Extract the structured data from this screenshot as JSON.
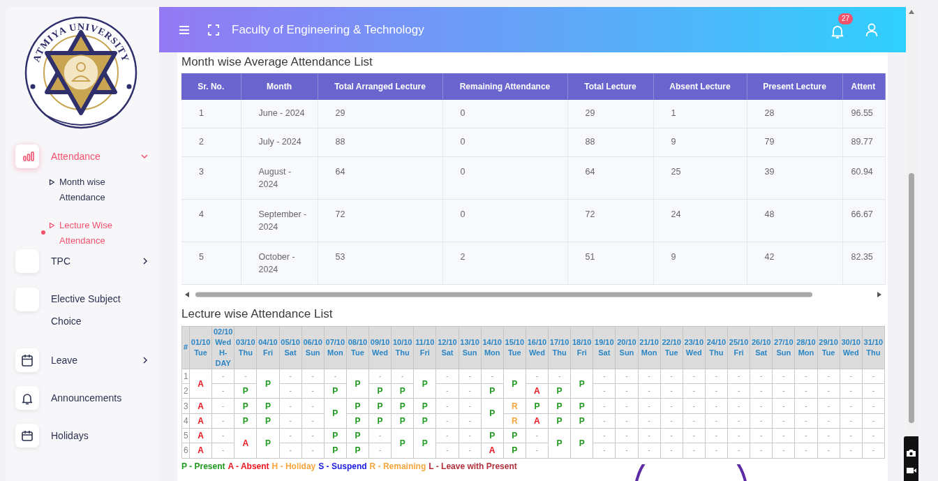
{
  "header": {
    "title": "Faculty of Engineering & Technology",
    "notification_count": "27"
  },
  "sidebar": {
    "logo": {
      "name": "ATMIYA UNIVERSITY"
    },
    "items": [
      {
        "label": "Attendance",
        "kind": "menu",
        "selected": true,
        "expanded": true,
        "children": [
          {
            "label": "Month wise Attendance",
            "selected": false
          },
          {
            "label": "Lecture Wise Attendance",
            "selected": true
          }
        ]
      },
      {
        "label": "TPC",
        "kind": "menu",
        "selected": false,
        "expanded": false
      },
      {
        "label": "Elective Subject Choice",
        "kind": "link",
        "selected": false
      },
      {
        "label": "Leave",
        "kind": "menu",
        "selected": false,
        "expanded": false
      },
      {
        "label": "Announcements",
        "kind": "link",
        "selected": false
      },
      {
        "label": "Holidays",
        "kind": "link",
        "selected": false
      }
    ]
  },
  "month_table": {
    "title": "Month wise Average Attendance List",
    "columns": [
      "Sr. No.",
      "Month",
      "Total Arranged Lecture",
      "Remaining Attendance",
      "Total Lecture",
      "Absent Lecture",
      "Present Lecture",
      "Attent"
    ],
    "rows": [
      [
        "1",
        "June - 2024",
        "29",
        "0",
        "29",
        "1",
        "28",
        "96.55"
      ],
      [
        "2",
        "July - 2024",
        "88",
        "0",
        "88",
        "9",
        "79",
        "89.77"
      ],
      [
        "3",
        "August - 2024",
        "64",
        "0",
        "64",
        "25",
        "39",
        "60.94"
      ],
      [
        "4",
        "September - 2024",
        "72",
        "0",
        "72",
        "24",
        "48",
        "66.67"
      ],
      [
        "5",
        "October - 2024",
        "53",
        "2",
        "51",
        "9",
        "42",
        "82.35"
      ]
    ]
  },
  "lecture_table": {
    "title": "Lecture wise Attendance List",
    "number_header": "#",
    "lecture_numbers": [
      "1",
      "2",
      "3",
      "4",
      "5",
      "6"
    ],
    "days": [
      {
        "date": "01/10",
        "weekday": "Tue",
        "slots": [
          {
            "mark": "A",
            "kind": "absent",
            "merged": false
          },
          {
            "merged": true
          },
          {
            "mark": "A",
            "kind": "absent",
            "merged": false
          },
          {
            "mark": "A",
            "kind": "absent",
            "merged": false
          },
          {
            "mark": "A",
            "kind": "absent",
            "merged": false
          },
          {
            "mark": "A",
            "kind": "absent",
            "merged": false
          }
        ]
      },
      {
        "date": "02/10",
        "weekday": "Wed",
        "note": "H-DAY",
        "slots": [
          {
            "mark": "-",
            "kind": "none",
            "merged": false
          },
          {
            "mark": "-",
            "kind": "none",
            "merged": false
          },
          {
            "mark": "-",
            "kind": "none",
            "merged": false
          },
          {
            "mark": "-",
            "kind": "none",
            "merged": false
          },
          {
            "mark": "-",
            "kind": "none",
            "merged": false
          },
          {
            "mark": "-",
            "kind": "none",
            "merged": false
          }
        ]
      },
      {
        "date": "03/10",
        "weekday": "Thu",
        "slots": [
          {
            "mark": "-",
            "kind": "none",
            "merged": false
          },
          {
            "mark": "P",
            "kind": "present",
            "merged": false
          },
          {
            "mark": "P",
            "kind": "present",
            "merged": false
          },
          {
            "mark": "P",
            "kind": "present",
            "merged": false
          },
          {
            "mark": "A",
            "kind": "absent",
            "merged": false
          },
          {
            "merged": true
          }
        ]
      },
      {
        "date": "04/10",
        "weekday": "Fri",
        "slots": [
          {
            "mark": "P",
            "kind": "present",
            "merged": false
          },
          {
            "merged": true
          },
          {
            "mark": "P",
            "kind": "present",
            "merged": false
          },
          {
            "mark": "P",
            "kind": "present",
            "merged": false
          },
          {
            "mark": "P",
            "kind": "present",
            "merged": false
          },
          {
            "merged": true
          }
        ]
      },
      {
        "date": "05/10",
        "weekday": "Sat",
        "slots": [
          {
            "mark": "-",
            "kind": "none",
            "merged": false
          },
          {
            "mark": "-",
            "kind": "none",
            "merged": false
          },
          {
            "mark": "-",
            "kind": "none",
            "merged": false
          },
          {
            "mark": "-",
            "kind": "none",
            "merged": false
          },
          {
            "mark": "-",
            "kind": "none",
            "merged": false
          },
          {
            "mark": "-",
            "kind": "none",
            "merged": false
          }
        ]
      },
      {
        "date": "06/10",
        "weekday": "Sun",
        "slots": [
          {
            "mark": "-",
            "kind": "none",
            "merged": false
          },
          {
            "mark": "-",
            "kind": "none",
            "merged": false
          },
          {
            "mark": "-",
            "kind": "none",
            "merged": false
          },
          {
            "mark": "-",
            "kind": "none",
            "merged": false
          },
          {
            "mark": "-",
            "kind": "none",
            "merged": false
          },
          {
            "mark": "-",
            "kind": "none",
            "merged": false
          }
        ]
      },
      {
        "date": "07/10",
        "weekday": "Mon",
        "slots": [
          {
            "mark": "-",
            "kind": "none",
            "merged": false
          },
          {
            "mark": "P",
            "kind": "present",
            "merged": false
          },
          {
            "mark": "P",
            "kind": "present",
            "merged": false
          },
          {
            "merged": true
          },
          {
            "mark": "P",
            "kind": "present",
            "merged": false
          },
          {
            "mark": "P",
            "kind": "present",
            "merged": false
          }
        ]
      },
      {
        "date": "08/10",
        "weekday": "Tue",
        "slots": [
          {
            "mark": "P",
            "kind": "present",
            "merged": false
          },
          {
            "merged": true
          },
          {
            "mark": "P",
            "kind": "present",
            "merged": false
          },
          {
            "mark": "P",
            "kind": "present",
            "merged": false
          },
          {
            "mark": "P",
            "kind": "present",
            "merged": false
          },
          {
            "mark": "P",
            "kind": "present",
            "merged": false
          }
        ]
      },
      {
        "date": "09/10",
        "weekday": "Wed",
        "slots": [
          {
            "mark": "-",
            "kind": "none",
            "merged": false
          },
          {
            "mark": "P",
            "kind": "present",
            "merged": false
          },
          {
            "mark": "P",
            "kind": "present",
            "merged": false
          },
          {
            "mark": "P",
            "kind": "present",
            "merged": false
          },
          {
            "mark": "-",
            "kind": "none",
            "merged": false
          },
          {
            "mark": "-",
            "kind": "none",
            "merged": false
          }
        ]
      },
      {
        "date": "10/10",
        "weekday": "Thu",
        "slots": [
          {
            "mark": "-",
            "kind": "none",
            "merged": false
          },
          {
            "mark": "P",
            "kind": "present",
            "merged": false
          },
          {
            "mark": "P",
            "kind": "present",
            "merged": false
          },
          {
            "mark": "P",
            "kind": "present",
            "merged": false
          },
          {
            "mark": "P",
            "kind": "present",
            "merged": false
          },
          {
            "merged": true
          }
        ]
      },
      {
        "date": "11/10",
        "weekday": "Fri",
        "slots": [
          {
            "mark": "P",
            "kind": "present",
            "merged": false
          },
          {
            "merged": true
          },
          {
            "mark": "P",
            "kind": "present",
            "merged": false
          },
          {
            "mark": "P",
            "kind": "present",
            "merged": false
          },
          {
            "mark": "P",
            "kind": "present",
            "merged": false
          },
          {
            "merged": true
          }
        ]
      },
      {
        "date": "12/10",
        "weekday": "Sat",
        "slots": [
          {
            "mark": "-",
            "kind": "none",
            "merged": false
          },
          {
            "mark": "-",
            "kind": "none",
            "merged": false
          },
          {
            "mark": "-",
            "kind": "none",
            "merged": false
          },
          {
            "mark": "-",
            "kind": "none",
            "merged": false
          },
          {
            "mark": "-",
            "kind": "none",
            "merged": false
          },
          {
            "mark": "-",
            "kind": "none",
            "merged": false
          }
        ]
      },
      {
        "date": "13/10",
        "weekday": "Sun",
        "slots": [
          {
            "mark": "-",
            "kind": "none",
            "merged": false
          },
          {
            "mark": "-",
            "kind": "none",
            "merged": false
          },
          {
            "mark": "-",
            "kind": "none",
            "merged": false
          },
          {
            "mark": "-",
            "kind": "none",
            "merged": false
          },
          {
            "mark": "-",
            "kind": "none",
            "merged": false
          },
          {
            "mark": "-",
            "kind": "none",
            "merged": false
          }
        ]
      },
      {
        "date": "14/10",
        "weekday": "Mon",
        "slots": [
          {
            "mark": "-",
            "kind": "none",
            "merged": false
          },
          {
            "mark": "P",
            "kind": "present",
            "merged": false
          },
          {
            "mark": "P",
            "kind": "present",
            "merged": false
          },
          {
            "merged": true
          },
          {
            "mark": "P",
            "kind": "present",
            "merged": false
          },
          {
            "mark": "A",
            "kind": "absent",
            "merged": false
          }
        ]
      },
      {
        "date": "15/10",
        "weekday": "Tue",
        "slots": [
          {
            "mark": "P",
            "kind": "present",
            "merged": false
          },
          {
            "merged": true
          },
          {
            "mark": "R",
            "kind": "remaining",
            "merged": false
          },
          {
            "mark": "R",
            "kind": "remaining",
            "merged": false
          },
          {
            "mark": "P",
            "kind": "present",
            "merged": false
          },
          {
            "mark": "P",
            "kind": "present",
            "merged": false
          }
        ]
      },
      {
        "date": "16/10",
        "weekday": "Wed",
        "slots": [
          {
            "mark": "-",
            "kind": "none",
            "merged": false
          },
          {
            "mark": "A",
            "kind": "absent",
            "merged": false
          },
          {
            "mark": "P",
            "kind": "present",
            "merged": false
          },
          {
            "mark": "A",
            "kind": "absent",
            "merged": false
          },
          {
            "mark": "-",
            "kind": "none",
            "merged": false
          },
          {
            "mark": "-",
            "kind": "none",
            "merged": false
          }
        ]
      },
      {
        "date": "17/10",
        "weekday": "Thu",
        "slots": [
          {
            "mark": "-",
            "kind": "none",
            "merged": false
          },
          {
            "mark": "P",
            "kind": "present",
            "merged": false
          },
          {
            "mark": "P",
            "kind": "present",
            "merged": false
          },
          {
            "mark": "P",
            "kind": "present",
            "merged": false
          },
          {
            "mark": "P",
            "kind": "present",
            "merged": false
          },
          {
            "merged": true
          }
        ]
      },
      {
        "date": "18/10",
        "weekday": "Fri",
        "slots": [
          {
            "mark": "P",
            "kind": "present",
            "merged": false
          },
          {
            "merged": true
          },
          {
            "mark": "P",
            "kind": "present",
            "merged": false
          },
          {
            "mark": "P",
            "kind": "present",
            "merged": false
          },
          {
            "mark": "P",
            "kind": "present",
            "merged": false
          },
          {
            "merged": true
          }
        ]
      },
      {
        "date": "19/10",
        "weekday": "Sat",
        "slots": [
          {
            "mark": "-",
            "kind": "none",
            "merged": false
          },
          {
            "mark": "-",
            "kind": "none",
            "merged": false
          },
          {
            "mark": "-",
            "kind": "none",
            "merged": false
          },
          {
            "mark": "-",
            "kind": "none",
            "merged": false
          },
          {
            "mark": "-",
            "kind": "none",
            "merged": false
          },
          {
            "mark": "-",
            "kind": "none",
            "merged": false
          }
        ]
      },
      {
        "date": "20/10",
        "weekday": "Sun",
        "slots": [
          {
            "mark": "-",
            "kind": "none",
            "merged": false
          },
          {
            "mark": "-",
            "kind": "none",
            "merged": false
          },
          {
            "mark": "-",
            "kind": "none",
            "merged": false
          },
          {
            "mark": "-",
            "kind": "none",
            "merged": false
          },
          {
            "mark": "-",
            "kind": "none",
            "merged": false
          },
          {
            "mark": "-",
            "kind": "none",
            "merged": false
          }
        ]
      },
      {
        "date": "21/10",
        "weekday": "Mon",
        "slots": [
          {
            "mark": "-",
            "kind": "none",
            "merged": false
          },
          {
            "mark": "-",
            "kind": "none",
            "merged": false
          },
          {
            "mark": "-",
            "kind": "none",
            "merged": false
          },
          {
            "mark": "-",
            "kind": "none",
            "merged": false
          },
          {
            "mark": "-",
            "kind": "none",
            "merged": false
          },
          {
            "mark": "-",
            "kind": "none",
            "merged": false
          }
        ]
      },
      {
        "date": "22/10",
        "weekday": "Tue",
        "slots": [
          {
            "mark": "-",
            "kind": "none",
            "merged": false
          },
          {
            "mark": "-",
            "kind": "none",
            "merged": false
          },
          {
            "mark": "-",
            "kind": "none",
            "merged": false
          },
          {
            "mark": "-",
            "kind": "none",
            "merged": false
          },
          {
            "mark": "-",
            "kind": "none",
            "merged": false
          },
          {
            "mark": "-",
            "kind": "none",
            "merged": false
          }
        ]
      },
      {
        "date": "23/10",
        "weekday": "Wed",
        "slots": [
          {
            "mark": "-",
            "kind": "none",
            "merged": false
          },
          {
            "mark": "-",
            "kind": "none",
            "merged": false
          },
          {
            "mark": "-",
            "kind": "none",
            "merged": false
          },
          {
            "mark": "-",
            "kind": "none",
            "merged": false
          },
          {
            "mark": "-",
            "kind": "none",
            "merged": false
          },
          {
            "mark": "-",
            "kind": "none",
            "merged": false
          }
        ]
      },
      {
        "date": "24/10",
        "weekday": "Thu",
        "slots": [
          {
            "mark": "-",
            "kind": "none",
            "merged": false
          },
          {
            "mark": "-",
            "kind": "none",
            "merged": false
          },
          {
            "mark": "-",
            "kind": "none",
            "merged": false
          },
          {
            "mark": "-",
            "kind": "none",
            "merged": false
          },
          {
            "mark": "-",
            "kind": "none",
            "merged": false
          },
          {
            "mark": "-",
            "kind": "none",
            "merged": false
          }
        ]
      },
      {
        "date": "25/10",
        "weekday": "Fri",
        "slots": [
          {
            "mark": "-",
            "kind": "none",
            "merged": false
          },
          {
            "mark": "-",
            "kind": "none",
            "merged": false
          },
          {
            "mark": "-",
            "kind": "none",
            "merged": false
          },
          {
            "mark": "-",
            "kind": "none",
            "merged": false
          },
          {
            "mark": "-",
            "kind": "none",
            "merged": false
          },
          {
            "mark": "-",
            "kind": "none",
            "merged": false
          }
        ]
      },
      {
        "date": "26/10",
        "weekday": "Sat",
        "slots": [
          {
            "mark": "-",
            "kind": "none",
            "merged": false
          },
          {
            "mark": "-",
            "kind": "none",
            "merged": false
          },
          {
            "mark": "-",
            "kind": "none",
            "merged": false
          },
          {
            "mark": "-",
            "kind": "none",
            "merged": false
          },
          {
            "mark": "-",
            "kind": "none",
            "merged": false
          },
          {
            "mark": "-",
            "kind": "none",
            "merged": false
          }
        ]
      },
      {
        "date": "27/10",
        "weekday": "Sun",
        "slots": [
          {
            "mark": "-",
            "kind": "none",
            "merged": false
          },
          {
            "mark": "-",
            "kind": "none",
            "merged": false
          },
          {
            "mark": "-",
            "kind": "none",
            "merged": false
          },
          {
            "mark": "-",
            "kind": "none",
            "merged": false
          },
          {
            "mark": "-",
            "kind": "none",
            "merged": false
          },
          {
            "mark": "-",
            "kind": "none",
            "merged": false
          }
        ]
      },
      {
        "date": "28/10",
        "weekday": "Mon",
        "slots": [
          {
            "mark": "-",
            "kind": "none",
            "merged": false
          },
          {
            "mark": "-",
            "kind": "none",
            "merged": false
          },
          {
            "mark": "-",
            "kind": "none",
            "merged": false
          },
          {
            "mark": "-",
            "kind": "none",
            "merged": false
          },
          {
            "mark": "-",
            "kind": "none",
            "merged": false
          },
          {
            "mark": "-",
            "kind": "none",
            "merged": false
          }
        ]
      },
      {
        "date": "29/10",
        "weekday": "Tue",
        "slots": [
          {
            "mark": "-",
            "kind": "none",
            "merged": false
          },
          {
            "mark": "-",
            "kind": "none",
            "merged": false
          },
          {
            "mark": "-",
            "kind": "none",
            "merged": false
          },
          {
            "mark": "-",
            "kind": "none",
            "merged": false
          },
          {
            "mark": "-",
            "kind": "none",
            "merged": false
          },
          {
            "mark": "-",
            "kind": "none",
            "merged": false
          }
        ]
      },
      {
        "date": "30/10",
        "weekday": "Wed",
        "slots": [
          {
            "mark": "-",
            "kind": "none",
            "merged": false
          },
          {
            "mark": "-",
            "kind": "none",
            "merged": false
          },
          {
            "mark": "-",
            "kind": "none",
            "merged": false
          },
          {
            "mark": "-",
            "kind": "none",
            "merged": false
          },
          {
            "mark": "-",
            "kind": "none",
            "merged": false
          },
          {
            "mark": "-",
            "kind": "none",
            "merged": false
          }
        ]
      },
      {
        "date": "31/10",
        "weekday": "Thu",
        "slots": [
          {
            "mark": "-",
            "kind": "none",
            "merged": false
          },
          {
            "mark": "-",
            "kind": "none",
            "merged": false
          },
          {
            "mark": "-",
            "kind": "none",
            "merged": false
          },
          {
            "mark": "-",
            "kind": "none",
            "merged": false
          },
          {
            "mark": "-",
            "kind": "none",
            "merged": false
          },
          {
            "mark": "-",
            "kind": "none",
            "merged": false
          }
        ]
      }
    ],
    "legend": [
      {
        "text": "P - Present",
        "color": "#1e9a1e"
      },
      {
        "text": "A - Absent",
        "color": "#f0141e"
      },
      {
        "text": "H - Holiday",
        "color": "#f7a53c"
      },
      {
        "text": "S - Suspend",
        "color": "#1a1ae6"
      },
      {
        "text": "R - Remaining",
        "color": "#f7a53c"
      },
      {
        "text": "L - Leave with Present",
        "color": "#b0303c"
      }
    ]
  }
}
